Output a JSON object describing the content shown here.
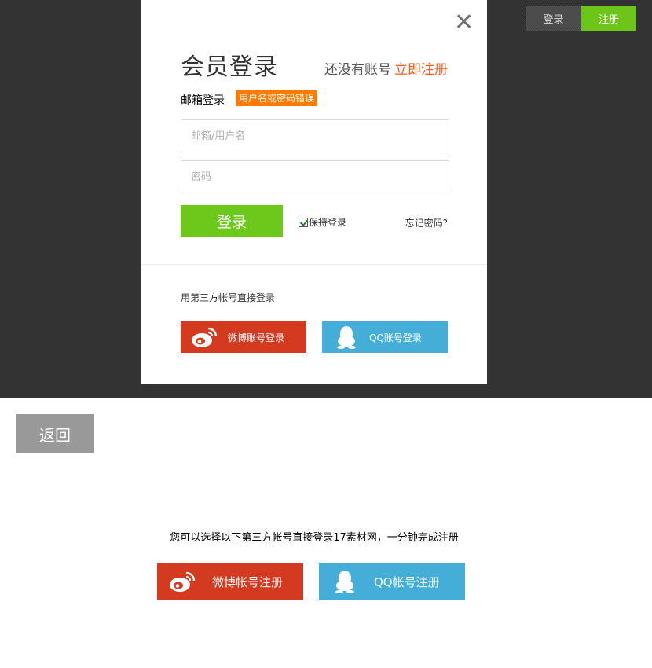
{
  "header": {
    "login_label": "登录",
    "register_label": "注册"
  },
  "modal": {
    "close_glyph": "✕",
    "title": "会员登录",
    "no_account_text": "还没有账号",
    "register_link": "立即注册",
    "email_login_label": "邮箱登录",
    "error_message": "用户名或密码错误",
    "username_placeholder": "邮箱/用户名",
    "password_placeholder": "密码",
    "login_button": "登录",
    "remember_label": "保持登录",
    "forgot_label": "忘记密码?",
    "third_party_label": "用第三方帐号直接登录",
    "weibo_login_label": "微博账号登录",
    "qq_login_label": "QQ账号登录"
  },
  "page": {
    "back_label": "返回",
    "info_text": "您可以选择以下第三方帐号直接登录17素材网，一分钟完成注册",
    "weibo_register_label": "微博帐号注册",
    "qq_register_label": "QQ帐号注册"
  },
  "icons": {
    "weibo": "weibo-icon",
    "qq": "qq-penguin-icon",
    "close": "close-icon",
    "check": "checkbox-checked"
  },
  "colors": {
    "overlay": "#333333",
    "green": "#6cc81a",
    "orange": "#ff7a00",
    "weibo_red": "#d33a1f",
    "qq_blue": "#44aed9",
    "grey_button": "#999999"
  }
}
